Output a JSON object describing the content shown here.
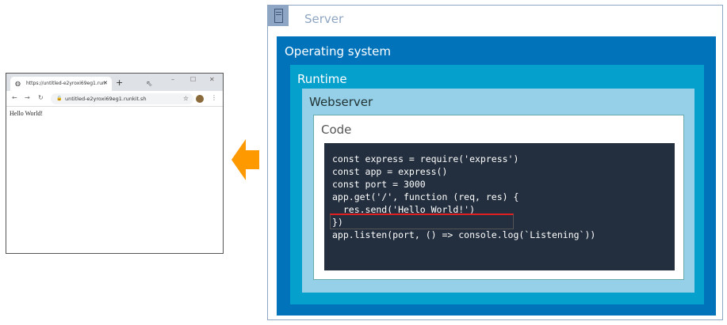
{
  "browser": {
    "tab_title": "https://untitled-e2yroxi69eg1.run",
    "url": "untitled-e2yroxi69eg1.runkit.sh",
    "page_text": "Hello World!"
  },
  "arrow": {
    "color": "#ff9900"
  },
  "diagram": {
    "server": "Server",
    "os": "Operating system",
    "runtime": "Runtime",
    "webserver": "Webserver",
    "code": "Code",
    "code_lines": [
      "const express = require('express')",
      "const app = express()",
      "const port = 3000",
      "",
      "app.get('/', function (req, res) {",
      "  res.send('Hello World!')",
      "})",
      "app.listen(port, () => console.log(`Listening`))"
    ]
  }
}
